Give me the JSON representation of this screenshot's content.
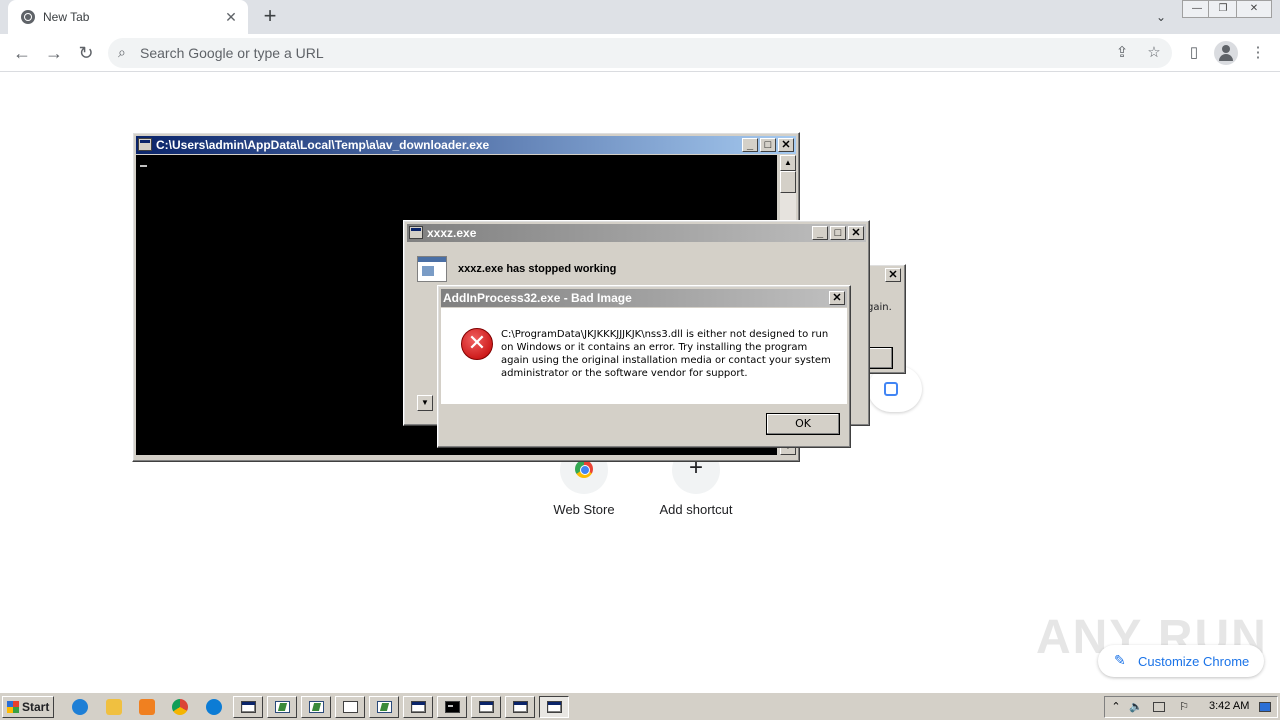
{
  "browser": {
    "tab": {
      "title": "New Tab",
      "close_glyph": "✕"
    },
    "new_tab_glyph": "+",
    "tab_search_glyph": "⌄",
    "window_controls": {
      "minimize": "—",
      "restore": "❐",
      "close": "✕"
    },
    "toolbar": {
      "back_glyph": "←",
      "forward_glyph": "→",
      "reload_glyph": "↻",
      "search_icon": "⌕",
      "omnibox_placeholder": "Search Google or type a URL",
      "share_glyph": "⇪",
      "bookmark_glyph": "☆",
      "sidepanel_glyph": "▯",
      "menu_glyph": "⋮"
    }
  },
  "new_tab_page": {
    "shortcuts": [
      {
        "label": "Web Store",
        "icon": "webstore-icon"
      },
      {
        "label": "Add shortcut",
        "icon": "plus-icon",
        "glyph": "+"
      }
    ],
    "customize_label": "Customize Chrome",
    "customize_glyph": "✎",
    "watermark": "ANY RUN"
  },
  "windows": {
    "console": {
      "title": "C:\\Users\\admin\\AppData\\Local\\Temp\\a\\av_downloader.exe",
      "buttons": {
        "minimize": "_",
        "maximize": "□",
        "close": "✕"
      },
      "scroll_up": "▲",
      "scroll_down": "▼"
    },
    "stopped": {
      "title": "xxxz.exe",
      "message": "xxxz.exe has stopped working",
      "buttons": {
        "minimize": "_",
        "maximize": "□",
        "close": "✕"
      },
      "scroll_down": "▼"
    },
    "background_dialog": {
      "partial_text": "gain.",
      "close": "✕"
    },
    "bad_image": {
      "title": "AddInProcess32.exe - Bad Image",
      "close": "✕",
      "error_glyph": "✕",
      "message": "C:\\ProgramData\\JKJKKKJJJKJK\\nss3.dll is either not designed to run on Windows or it contains an error. Try installing the program again using the original installation media or contact your system administrator or the software vendor for support.",
      "ok_label": "OK"
    }
  },
  "taskbar": {
    "start_label": "Start",
    "clock": "3:42 AM",
    "tray_expand_glyph": "⌃",
    "tray_volume_glyph": "🔈",
    "tray_flag_glyph": "⚐",
    "colors": {
      "ie": "#1e7fd6",
      "explorer": "#f0c040",
      "media": "#f08020",
      "chrome": "#db4437",
      "edge": "#0c7cd5"
    }
  }
}
